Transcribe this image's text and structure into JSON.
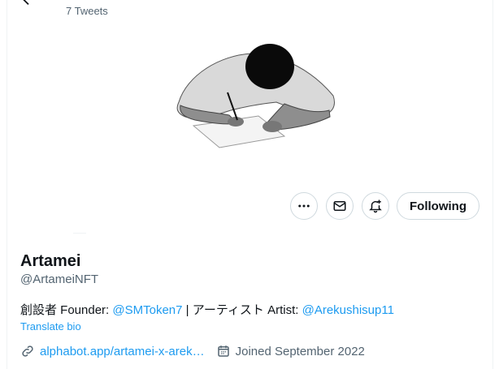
{
  "header": {
    "tweet_count": "7 Tweets"
  },
  "actions": {
    "follow_label": "Following"
  },
  "profile": {
    "name": "Artamei",
    "handle": "@ArtameiNFT",
    "bio_prefix": "創設者 Founder: ",
    "bio_mention_1": "@SMToken7",
    "bio_middle": " | アーティスト Artist: ",
    "bio_mention_2": "@Arekushisup11",
    "translate": "Translate bio",
    "website": "alphabot.app/artamei-x-arek…",
    "joined": "Joined September 2022"
  },
  "colors": {
    "link": "#1d9bf0",
    "muted": "#536471",
    "border": "#cfd9de"
  }
}
